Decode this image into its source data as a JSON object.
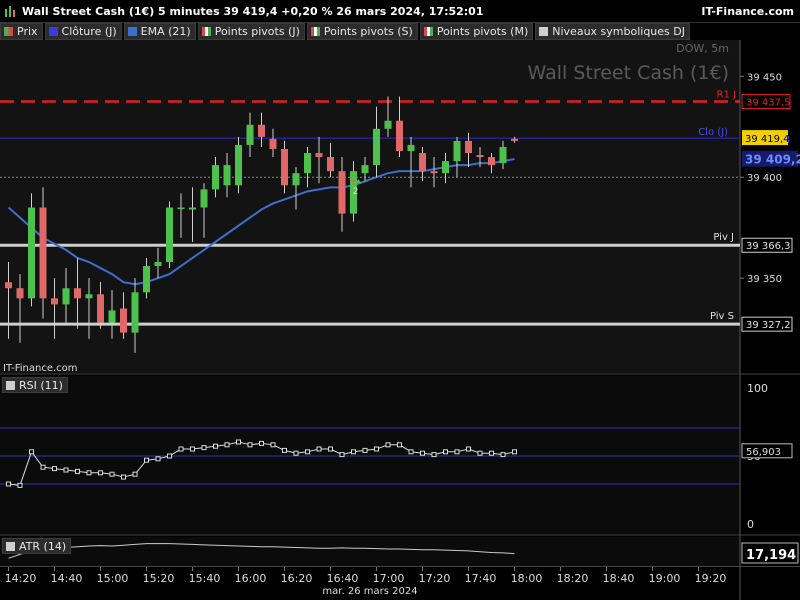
{
  "header": {
    "title": "Wall Street Cash (1€) 5 minutes 39 419,4 +0,20 % 26 mars 2024, 17:52:01",
    "brand": "IT-Finance.com"
  },
  "legend": [
    {
      "label": "Prix",
      "swatch": "split"
    },
    {
      "label": "Clôture (J)",
      "swatch": "blue"
    },
    {
      "label": "EMA (21)",
      "swatch": "ema"
    },
    {
      "label": "Points pivots (J)",
      "swatch": "pivot"
    },
    {
      "label": "Points pivots (S)",
      "swatch": "pivot"
    },
    {
      "label": "Points pivots (M)",
      "swatch": "pivot"
    },
    {
      "label": "Niveaux symboliques DJ",
      "swatch": "gray"
    }
  ],
  "watermark": {
    "small": "DOW, 5m",
    "large": "Wall Street Cash (1€)",
    "source": "IT-Finance.com"
  },
  "colors": {
    "up": "#4cc24c",
    "down": "#e06868",
    "ema": "#3c6fd0",
    "close_line": "#2a2ad0",
    "r1": "#e02020",
    "pivot": "#cfcfcf",
    "rsi": "#dddddd",
    "atr": "#cccccc",
    "last_price_bg": "#f2d000",
    "ema_tag_bg": "#1a1a6a",
    "rsi_band": "#3030c0"
  },
  "chart_data": [
    {
      "type": "candlestick",
      "title": "Wall Street Cash (1€)",
      "x_ticks": [
        "14:20",
        "14:40",
        "15:00",
        "15:20",
        "15:40",
        "16:00",
        "16:20",
        "16:40",
        "17:00",
        "17:20",
        "17:40",
        "18:00",
        "18:20",
        "18:40",
        "19:00",
        "19:20"
      ],
      "x_date": "mar. 26 mars 2024",
      "y_ticks": [
        39450,
        39400,
        39350
      ],
      "y_tick_labels": [
        "39 450",
        "39 400",
        "39 350"
      ],
      "ylim": [
        39303,
        39468
      ],
      "bar_interval_minutes": 5,
      "first_bar": "14:20",
      "candles": [
        {
          "o": 39348,
          "h": 39358,
          "l": 39320,
          "c": 39345
        },
        {
          "o": 39345,
          "h": 39352,
          "l": 39318,
          "c": 39340
        },
        {
          "o": 39340,
          "h": 39392,
          "l": 39336,
          "c": 39385
        },
        {
          "o": 39385,
          "h": 39395,
          "l": 39330,
          "c": 39340
        },
        {
          "o": 39340,
          "h": 39350,
          "l": 39320,
          "c": 39337
        },
        {
          "o": 39337,
          "h": 39355,
          "l": 39328,
          "c": 39345
        },
        {
          "o": 39345,
          "h": 39360,
          "l": 39325,
          "c": 39340
        },
        {
          "o": 39340,
          "h": 39350,
          "l": 39320,
          "c": 39342
        },
        {
          "o": 39342,
          "h": 39348,
          "l": 39325,
          "c": 39328
        },
        {
          "o": 39328,
          "h": 39344,
          "l": 39320,
          "c": 39334
        },
        {
          "o": 39335,
          "h": 39343,
          "l": 39320,
          "c": 39323
        },
        {
          "o": 39323,
          "h": 39350,
          "l": 39313,
          "c": 39343
        },
        {
          "o": 39343,
          "h": 39360,
          "l": 39340,
          "c": 39356
        },
        {
          "o": 39356,
          "h": 39365,
          "l": 39350,
          "c": 39358
        },
        {
          "o": 39358,
          "h": 39388,
          "l": 39355,
          "c": 39385
        },
        {
          "o": 39385,
          "h": 39392,
          "l": 39370,
          "c": 39385
        },
        {
          "o": 39384,
          "h": 39395,
          "l": 39368,
          "c": 39385
        },
        {
          "o": 39385,
          "h": 39397,
          "l": 39370,
          "c": 39394
        },
        {
          "o": 39394,
          "h": 39410,
          "l": 39390,
          "c": 39406
        },
        {
          "o": 39396,
          "h": 39412,
          "l": 39390,
          "c": 39406
        },
        {
          "o": 39396,
          "h": 39420,
          "l": 39392,
          "c": 39416
        },
        {
          "o": 39416,
          "h": 39432,
          "l": 39410,
          "c": 39426
        },
        {
          "o": 39426,
          "h": 39432,
          "l": 39415,
          "c": 39420
        },
        {
          "o": 39419,
          "h": 39424,
          "l": 39410,
          "c": 39414
        },
        {
          "o": 39414,
          "h": 39418,
          "l": 39392,
          "c": 39396
        },
        {
          "o": 39396,
          "h": 39405,
          "l": 39384,
          "c": 39402
        },
        {
          "o": 39402,
          "h": 39415,
          "l": 39395,
          "c": 39412
        },
        {
          "o": 39412,
          "h": 39420,
          "l": 39397,
          "c": 39410
        },
        {
          "o": 39410,
          "h": 39417,
          "l": 39400,
          "c": 39403
        },
        {
          "o": 39403,
          "h": 39410,
          "l": 39373,
          "c": 39382
        },
        {
          "o": 39382,
          "h": 39408,
          "l": 39378,
          "c": 39403
        },
        {
          "o": 39402,
          "h": 39410,
          "l": 39398,
          "c": 39406
        },
        {
          "o": 39406,
          "h": 39435,
          "l": 39400,
          "c": 39424
        },
        {
          "o": 39424,
          "h": 39440,
          "l": 39420,
          "c": 39428
        },
        {
          "o": 39428,
          "h": 39440,
          "l": 39410,
          "c": 39413
        },
        {
          "o": 39413,
          "h": 39420,
          "l": 39395,
          "c": 39416
        },
        {
          "o": 39412,
          "h": 39415,
          "l": 39398,
          "c": 39403
        },
        {
          "o": 39403,
          "h": 39410,
          "l": 39395,
          "c": 39402
        },
        {
          "o": 39402,
          "h": 39412,
          "l": 39397,
          "c": 39408
        },
        {
          "o": 39408,
          "h": 39420,
          "l": 39400,
          "c": 39418
        },
        {
          "o": 39418,
          "h": 39422,
          "l": 39405,
          "c": 39412
        },
        {
          "o": 39411,
          "h": 39415,
          "l": 39405,
          "c": 39410
        },
        {
          "o": 39410,
          "h": 39412,
          "l": 39402,
          "c": 39406
        },
        {
          "o": 39407,
          "h": 39418,
          "l": 39404,
          "c": 39415
        },
        {
          "o": 39419,
          "h": 39420,
          "l": 39417,
          "c": 39418
        }
      ],
      "ema21": [
        39385,
        39380,
        39375,
        39370,
        39367,
        39364,
        39360,
        39358,
        39355,
        39352,
        39348,
        39347,
        39348,
        39350,
        39352,
        39356,
        39360,
        39364,
        39368,
        39372,
        39376,
        39380,
        39384,
        39387,
        39389,
        39391,
        39393,
        39394,
        39395,
        39395,
        39396,
        39398,
        39400,
        39402,
        39403,
        39403,
        39403,
        39404,
        39405,
        39406,
        39406,
        39407,
        39407,
        39408,
        39409
      ],
      "levels": [
        {
          "name": "R1 J",
          "value": 39437.5,
          "label": "39 437,5",
          "style": "dashed",
          "color": "#e02020"
        },
        {
          "name": "Clo (J)",
          "value": 39419.4,
          "label": "39 419,4",
          "style": "solid",
          "color": "#2a2ad0"
        },
        {
          "name": "Piv J",
          "value": 39366.3,
          "label": "39 366,3",
          "style": "solid",
          "color": "#cfcfcf"
        },
        {
          "name": "Piv S",
          "value": 39327.2,
          "label": "39 327,2",
          "style": "solid",
          "color": "#cfcfcf"
        }
      ],
      "symbolic_level": {
        "value": 39400,
        "style": "dotted"
      },
      "last_price": {
        "value": 39419.4,
        "label": "39 419,4"
      },
      "ema_last": {
        "value": 39409.2,
        "label": "39 409,2"
      },
      "annotation": {
        "text": "2",
        "bar_index": 30
      }
    },
    {
      "type": "line",
      "name": "RSI (11)",
      "ylim": [
        0,
        100
      ],
      "y_ticks": [
        100,
        50,
        0
      ],
      "y_tick_labels": [
        "100",
        "50",
        "0"
      ],
      "bands": [
        70,
        50,
        30
      ],
      "last_label": "56,903",
      "values": [
        30,
        29,
        53,
        42,
        41,
        40,
        39,
        38,
        38,
        37,
        35,
        37,
        47,
        48,
        50,
        55,
        55,
        56,
        57,
        58,
        60,
        58,
        59,
        58,
        54,
        52,
        53,
        55,
        55,
        51,
        53,
        54,
        55,
        58,
        58,
        53,
        52,
        51,
        53,
        53,
        55,
        52,
        52,
        51,
        53
      ]
    },
    {
      "type": "line",
      "name": "ATR (14)",
      "last_label": "17,194",
      "values": [
        16,
        17,
        18,
        18,
        18.5,
        18.8,
        19,
        19.2,
        19.3,
        19.2,
        19.4,
        19.6,
        19.8,
        19.8,
        19.8,
        19.7,
        19.6,
        19.5,
        19.4,
        19.3,
        19.2,
        19.1,
        19,
        19,
        18.9,
        18.8,
        18.7,
        18.6,
        18.6,
        18.7,
        18.6,
        18.6,
        18.5,
        18.4,
        18.4,
        18.3,
        18.2,
        18.2,
        18.1,
        18,
        17.9,
        17.7,
        17.5,
        17.4,
        17.2
      ]
    }
  ]
}
